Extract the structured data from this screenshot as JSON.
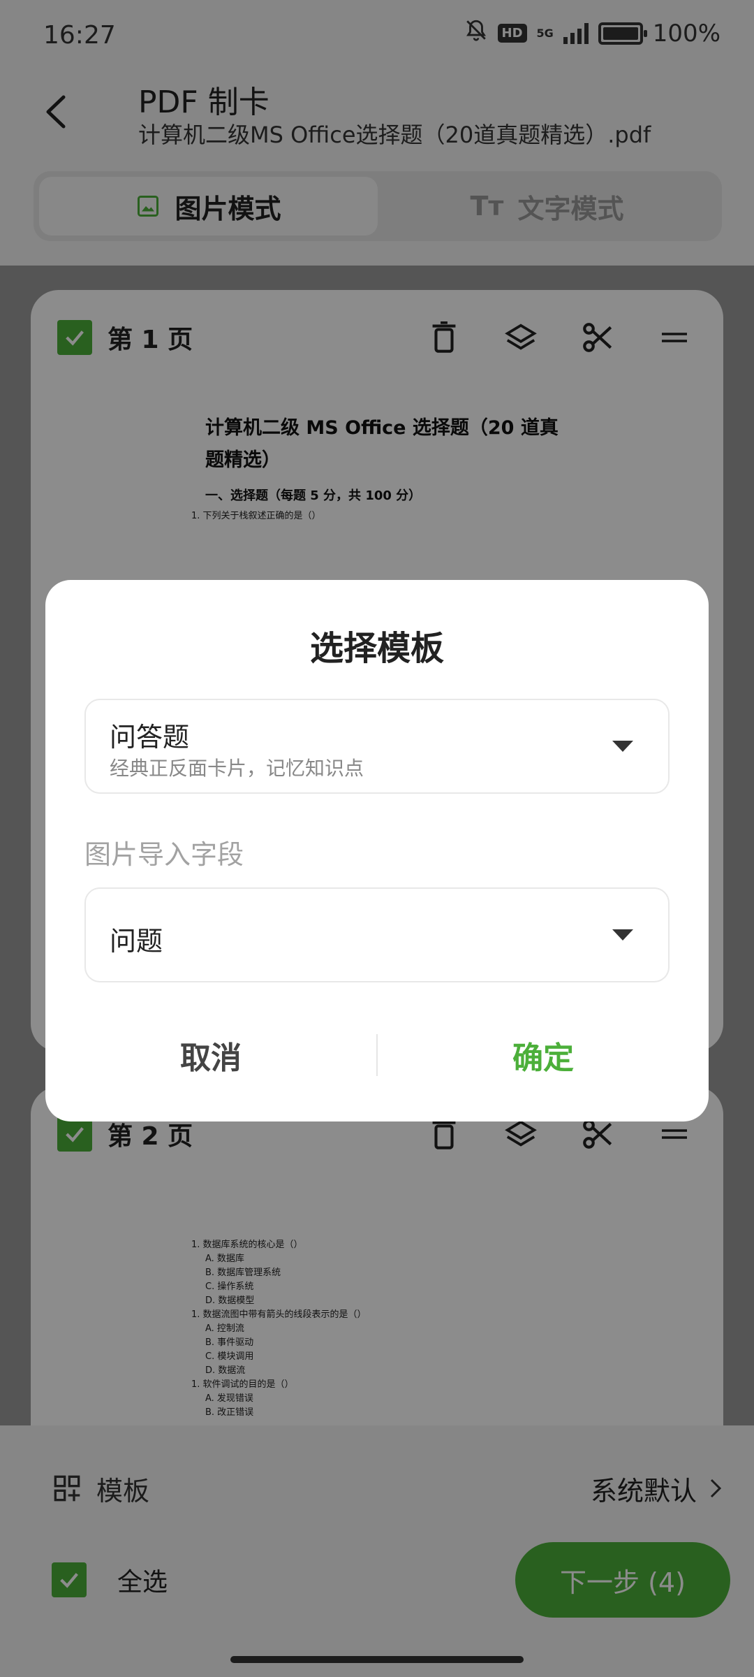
{
  "status": {
    "time": "16:27",
    "network": "5G",
    "hd_badge": "HD",
    "battery": "100%"
  },
  "header": {
    "title": "PDF 制卡",
    "subtitle": "计算机二级MS Office选择题（20道真题精选）.pdf"
  },
  "tabs": {
    "image_mode": "图片模式",
    "text_mode": "文字模式"
  },
  "pages": [
    {
      "label": "第 1 页",
      "pdf_title": "计算机二级 MS Office 选择题（20 道真题精选）",
      "pdf_section": "一、选择题（每题 5 分，共 100 分）",
      "pdf_lines": [
        "1.   下列关于栈叙述正确的是（）"
      ]
    },
    {
      "label": "第 2 页",
      "pdf_lines": [
        "1.   数据库系统的核心是（）",
        "A. 数据库",
        "B. 数据库管理系统",
        "C. 操作系统",
        "D. 数据模型",
        "1.   数据流图中带有箭头的线段表示的是（）",
        "A. 控制流",
        "B. 事件驱动",
        "C. 模块调用",
        "D. 数据流",
        "1.   软件调试的目的是（）",
        "A. 发现错误",
        "B. 改正错误"
      ]
    }
  ],
  "bottom": {
    "template_label": "模板",
    "template_value": "系统默认",
    "select_all": "全选",
    "next_button": "下一步 (4)"
  },
  "dialog": {
    "title": "选择模板",
    "template_name": "问答题",
    "template_desc": "经典正反面卡片，记忆知识点",
    "field_label": "图片导入字段",
    "field_value": "问题",
    "cancel": "取消",
    "confirm": "确定"
  },
  "colors": {
    "accent": "#4caf3a",
    "overlay": "rgba(0,0,0,0.45)"
  }
}
